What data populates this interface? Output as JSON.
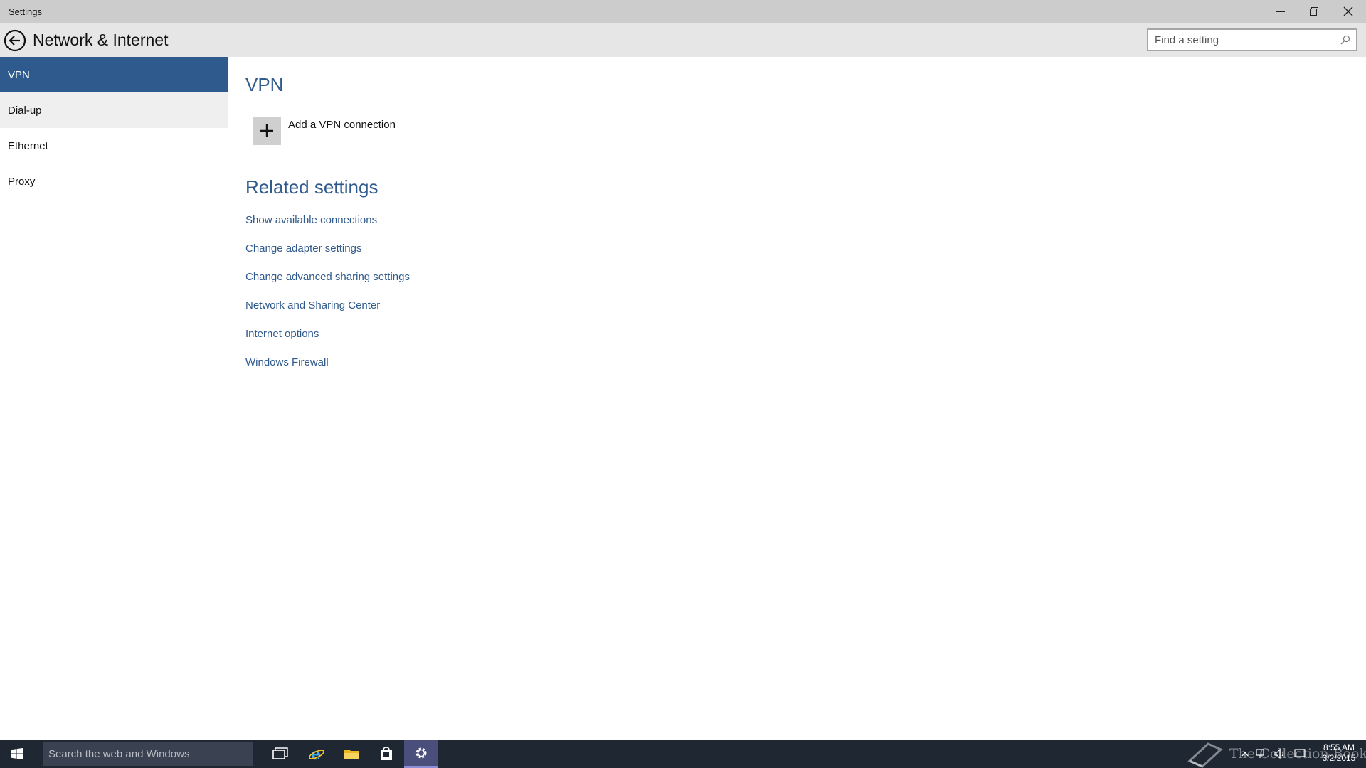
{
  "window": {
    "title": "Settings",
    "controls": {
      "minimize": "minimize-icon",
      "restore": "restore-icon",
      "close": "close-icon"
    }
  },
  "header": {
    "title": "Network & Internet",
    "search_placeholder": "Find a setting"
  },
  "sidebar": {
    "items": [
      {
        "label": "VPN",
        "state": "selected"
      },
      {
        "label": "Dial-up",
        "state": "hover"
      },
      {
        "label": "Ethernet",
        "state": "normal"
      },
      {
        "label": "Proxy",
        "state": "normal"
      }
    ]
  },
  "main": {
    "section_title": "VPN",
    "add_vpn_label": "Add a VPN connection",
    "related_title": "Related settings",
    "links": [
      "Show available connections",
      "Change adapter settings",
      "Change advanced sharing settings",
      "Network and Sharing Center",
      "Internet options",
      "Windows Firewall"
    ]
  },
  "taskbar": {
    "search_placeholder": "Search the web and Windows",
    "apps": [
      "task-view-icon",
      "internet-explorer-icon",
      "file-explorer-icon",
      "store-icon",
      "settings-icon"
    ],
    "watermark": "The Collection Book",
    "time": "8:55 AM",
    "date": "3/2/2015"
  },
  "colors": {
    "accent": "#2e5a8e",
    "link": "#2f5a8c",
    "titlebar": "#cccccc",
    "header": "#e6e6e6",
    "taskbar": "#1f2733"
  }
}
